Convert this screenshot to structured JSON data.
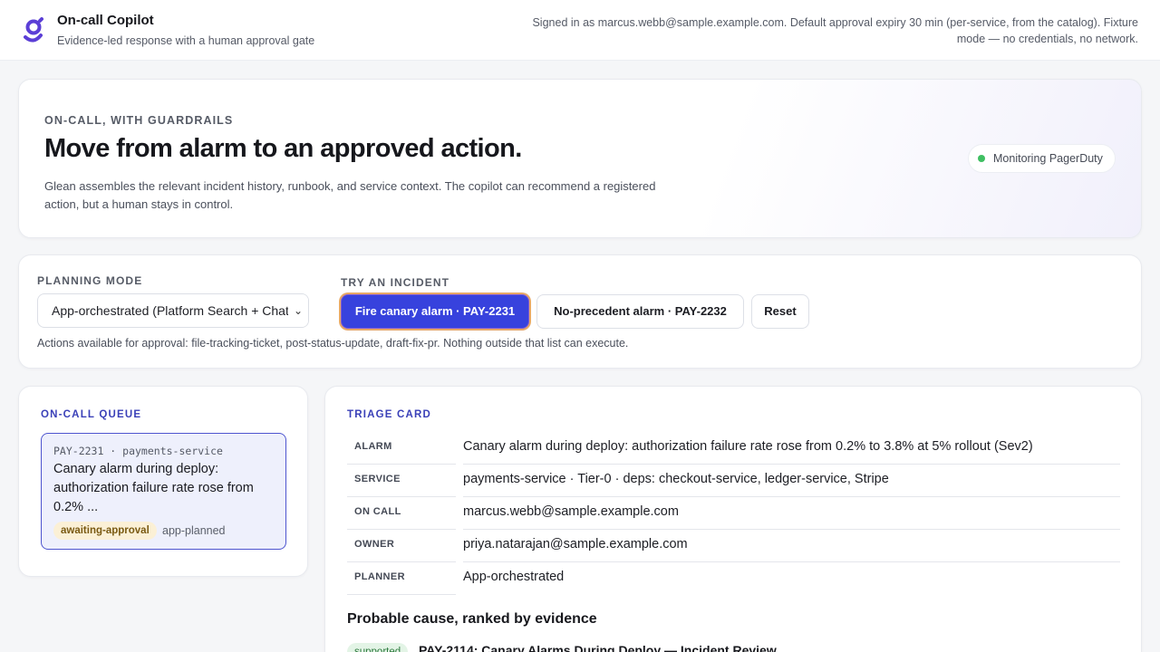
{
  "header": {
    "app_title": "On-call Copilot",
    "app_subtitle": "Evidence-led response with a human approval gate",
    "signed_in_text": "Signed in as marcus.webb@sample.example.com. Default approval expiry 30 min (per-service, from the catalog). Fixture mode — no credentials, no network.",
    "logo_icon": "g-logo-icon",
    "brand_color": "#5b3fd6"
  },
  "hero": {
    "eyebrow": "On-call, with guardrails",
    "title": "Move from alarm to an approved action.",
    "body": "Glean assembles the relevant incident history, runbook, and service context. The copilot can recommend a registered action, but a human stays in control.",
    "status": "Monitoring PagerDuty",
    "status_color": "#3fbf62"
  },
  "controls": {
    "planning_mode_label": "Planning mode",
    "planning_mode_value": "App-orchestrated (Platform Search + Chat)",
    "try_incident_label": "Try an incident",
    "btn_fire_canary": "Fire canary alarm · PAY-2231",
    "btn_no_precedent": "No-precedent alarm · PAY-2232",
    "btn_reset": "Reset",
    "note": "Actions available for approval: file-tracking-ticket, post-status-update, draft-fix-pr. Nothing outside that list can execute.",
    "accent_color": "#3742dd"
  },
  "queue": {
    "title": "On-call queue",
    "items": [
      {
        "meta": "PAY-2231 · payments-service",
        "summary": "Canary alarm during deploy: authorization failure rate rose from 0.2% ...",
        "state_badge": "awaiting-approval",
        "planner_tag": "app-planned"
      }
    ]
  },
  "triage": {
    "title": "Triage card",
    "rows": [
      {
        "key": "Alarm",
        "value": "Canary alarm during deploy: authorization failure rate rose from 0.2% to 3.8% at 5% rollout (Sev2)"
      },
      {
        "key": "Service",
        "value": "payments-service · Tier-0 · deps: checkout-service, ledger-service, Stripe"
      },
      {
        "key": "On call",
        "value": "marcus.webb@sample.example.com"
      },
      {
        "key": "Owner",
        "value": "priya.natarajan@sample.example.com"
      },
      {
        "key": "Planner",
        "value": "App-orchestrated"
      }
    ],
    "cause_title": "Probable cause, ranked by evidence",
    "evidence": [
      {
        "badge": "supported",
        "title": "PAY-2114: Canary Alarms During Deploy — Incident Review"
      }
    ]
  }
}
